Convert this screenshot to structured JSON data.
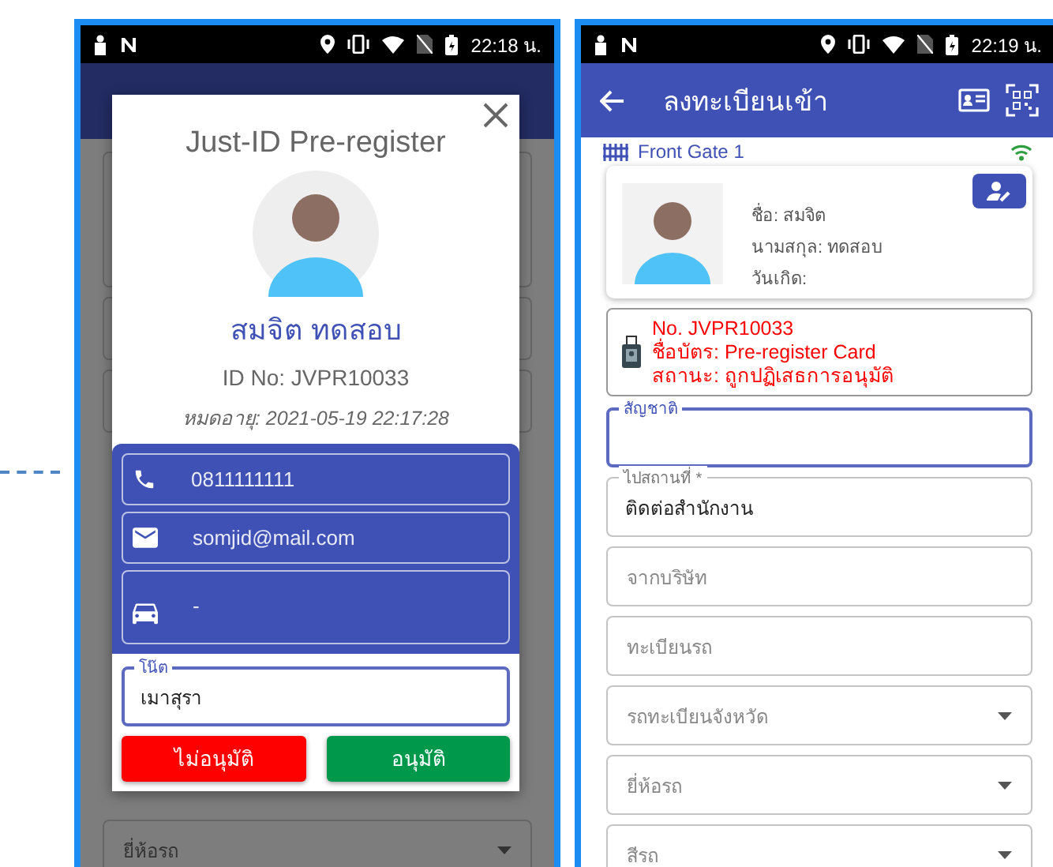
{
  "left_screen": {
    "status_bar": {
      "time": "22:18 น."
    },
    "background_fields": [
      {
        "placeholder": "ยี่ห้อรถ",
        "kind": "dropdown"
      }
    ],
    "dialog": {
      "title": "Just-ID Pre-register",
      "name": "สมจิต ทดสอบ",
      "id_no": "ID No: JVPR10033",
      "expiry": "หมดอายุ: 2021-05-19 22:17:28",
      "contacts": [
        {
          "kind": "phone",
          "value": "0811111111"
        },
        {
          "kind": "email",
          "value": "somjid@mail.com"
        },
        {
          "kind": "car",
          "value": "-"
        }
      ],
      "note": {
        "label": "โน๊ต",
        "value": "เมาสุรา"
      },
      "buttons": [
        {
          "kind": "reject",
          "label": "ไม่อนุมัติ"
        },
        {
          "kind": "approve",
          "label": "อนุมัติ"
        }
      ]
    }
  },
  "right_screen": {
    "status_bar": {
      "time": "22:19 น."
    },
    "app_bar": {
      "title": "ลงทะเบียนเข้า"
    },
    "gate": "Front Gate 1",
    "profile": {
      "lines": [
        "ชื่อ: สมจิต",
        "นามสกุล: ทดสอบ",
        "วันเกิด:"
      ]
    },
    "card": {
      "lines": [
        "No. JVPR10033",
        "ชื่อบัตร: Pre-register Card",
        "สถานะ: ถูกปฏิเสธการอนุมัติ"
      ]
    },
    "fields": [
      {
        "kind": "text",
        "label": "สัญชาติ",
        "focused": true
      },
      {
        "kind": "text",
        "label": "ไปสถานที่ *",
        "value": "ติดต่อสำนักงาน",
        "focused": false
      },
      {
        "kind": "text",
        "placeholder": "จากบริษัท",
        "focused": false
      },
      {
        "kind": "text",
        "placeholder": "ทะเบียนรถ",
        "focused": false
      },
      {
        "kind": "dropdown",
        "placeholder": "รถทะเบียนจังหวัด",
        "focused": false
      },
      {
        "kind": "dropdown",
        "placeholder": "ยี่ห้อรถ",
        "focused": false
      },
      {
        "kind": "dropdown",
        "placeholder": "สีรถ",
        "focused": false
      }
    ]
  }
}
